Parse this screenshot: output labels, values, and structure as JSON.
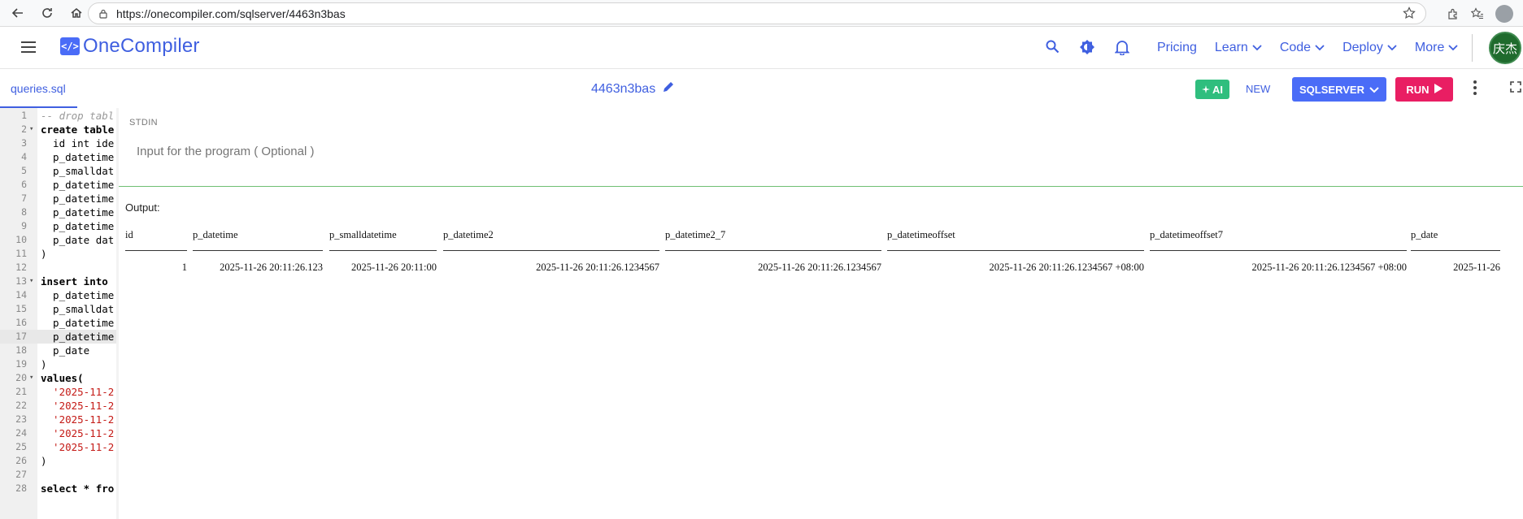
{
  "browser": {
    "url": "https://onecompiler.com/sqlserver/4463n3bas"
  },
  "header": {
    "brand": "OneCompiler",
    "logo_glyph": "</>",
    "nav": [
      {
        "label": "Pricing",
        "dropdown": false
      },
      {
        "label": "Learn",
        "dropdown": true
      },
      {
        "label": "Code",
        "dropdown": true
      },
      {
        "label": "Deploy",
        "dropdown": true
      },
      {
        "label": "More",
        "dropdown": true
      }
    ],
    "avatar_text": "庆杰"
  },
  "toolbar": {
    "file_tab": "queries.sql",
    "code_id": "4463n3bas",
    "ai_label": "AI",
    "new_label": "NEW",
    "language_label": "SQLSERVER",
    "run_label": "RUN"
  },
  "editor": {
    "active_line": 17,
    "lines": [
      {
        "n": "1",
        "fold": false,
        "text": "-- drop tabl",
        "kind": "comment"
      },
      {
        "n": "2",
        "fold": true,
        "text": "create table",
        "kind": "kw"
      },
      {
        "n": "3",
        "fold": false,
        "text": "  id int ide",
        "kind": "plain"
      },
      {
        "n": "4",
        "fold": false,
        "text": "  p_datetime",
        "kind": "plain"
      },
      {
        "n": "5",
        "fold": false,
        "text": "  p_smalldat",
        "kind": "plain"
      },
      {
        "n": "6",
        "fold": false,
        "text": "  p_datetime",
        "kind": "plain"
      },
      {
        "n": "7",
        "fold": false,
        "text": "  p_datetime",
        "kind": "plain"
      },
      {
        "n": "8",
        "fold": false,
        "text": "  p_datetime",
        "kind": "plain"
      },
      {
        "n": "9",
        "fold": false,
        "text": "  p_datetime",
        "kind": "plain"
      },
      {
        "n": "10",
        "fold": false,
        "text": "  p_date dat",
        "kind": "plain"
      },
      {
        "n": "11",
        "fold": false,
        "text": ")",
        "kind": "plain"
      },
      {
        "n": "12",
        "fold": false,
        "text": "",
        "kind": "plain"
      },
      {
        "n": "13",
        "fold": true,
        "text": "insert into",
        "kind": "kw"
      },
      {
        "n": "14",
        "fold": false,
        "text": "  p_datetime",
        "kind": "plain"
      },
      {
        "n": "15",
        "fold": false,
        "text": "  p_smalldat",
        "kind": "plain"
      },
      {
        "n": "16",
        "fold": false,
        "text": "  p_datetime",
        "kind": "plain"
      },
      {
        "n": "17",
        "fold": false,
        "text": "  p_datetime",
        "kind": "plain"
      },
      {
        "n": "18",
        "fold": false,
        "text": "  p_date",
        "kind": "plain"
      },
      {
        "n": "19",
        "fold": false,
        "text": ")",
        "kind": "plain"
      },
      {
        "n": "20",
        "fold": true,
        "text": "values(",
        "kind": "kw"
      },
      {
        "n": "21",
        "fold": false,
        "text": "  '2025-11-2",
        "kind": "str"
      },
      {
        "n": "22",
        "fold": false,
        "text": "  '2025-11-2",
        "kind": "str"
      },
      {
        "n": "23",
        "fold": false,
        "text": "  '2025-11-2",
        "kind": "str"
      },
      {
        "n": "24",
        "fold": false,
        "text": "  '2025-11-2",
        "kind": "str"
      },
      {
        "n": "25",
        "fold": false,
        "text": "  '2025-11-2",
        "kind": "str"
      },
      {
        "n": "26",
        "fold": false,
        "text": ")",
        "kind": "plain"
      },
      {
        "n": "27",
        "fold": false,
        "text": "",
        "kind": "plain"
      },
      {
        "n": "28",
        "fold": false,
        "text": "select * fro",
        "kind": "kw"
      }
    ]
  },
  "stdin": {
    "label": "STDIN",
    "placeholder": "Input for the program ( Optional )"
  },
  "output": {
    "label": "Output:",
    "columns": [
      "id",
      "p_datetime",
      "p_smalldatetime",
      "p_datetime2",
      "p_datetime2_7",
      "p_datetimeoffset",
      "p_datetimeoffset7",
      "p_date"
    ],
    "rows": [
      [
        "1",
        "2025-11-26 20:11:26.123",
        "2025-11-26 20:11:00",
        "2025-11-26 20:11:26.1234567",
        "2025-11-26 20:11:26.1234567",
        "2025-11-26 20:11:26.1234567 +08:00",
        "2025-11-26 20:11:26.1234567 +08:00",
        "2025-11-26"
      ]
    ]
  },
  "colors": {
    "brand": "#3f5fe0",
    "run": "#e91e63",
    "ai": "#2fbe7e",
    "language": "#4a6cf7",
    "stdin_divider": "#6fbf73"
  }
}
